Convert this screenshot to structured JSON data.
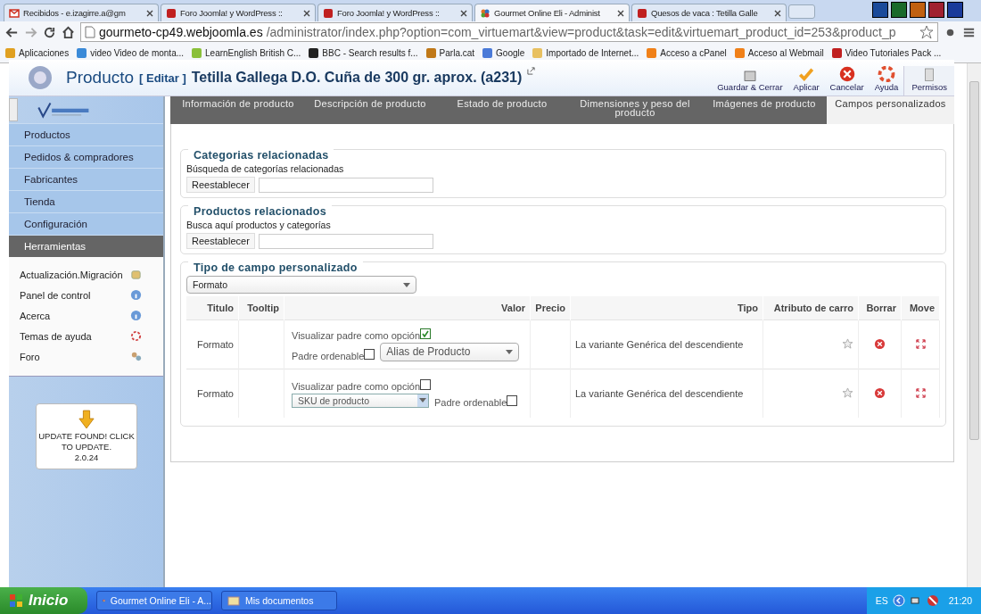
{
  "browser": {
    "tabs": [
      {
        "label": "Recibidos - e.izagirre.a@gm",
        "selected": false
      },
      {
        "label": "Foro Joomla! y WordPress ::",
        "selected": false
      },
      {
        "label": "Foro Joomla! y WordPress ::",
        "selected": false
      },
      {
        "label": "Gourmet Online Eli - Administ",
        "selected": true
      },
      {
        "label": "Quesos de vaca : Tetilla Galle",
        "selected": false
      }
    ],
    "address": {
      "host": "gourmeto-cp49.webjoomla.es",
      "path": "/administrator/index.php?option=com_virtuemart&view=product&task=edit&virtuemart_product_id=253&product_p"
    },
    "bookmarks": [
      {
        "label": "Aplicaciones",
        "color": "#e0a020"
      },
      {
        "label": "video Video de monta...",
        "color": "#3a8ad8"
      },
      {
        "label": "LearnEnglish  British C...",
        "color": "#8ac03a"
      },
      {
        "label": "BBC - Search results f...",
        "color": "#222222"
      },
      {
        "label": "Parla.cat",
        "color": "#c07818"
      },
      {
        "label": "Google",
        "color": "#4a7ad8"
      },
      {
        "label": "Importado de Internet...",
        "color": "#e8c060"
      },
      {
        "label": "Acceso a cPanel",
        "color": "#f08018"
      },
      {
        "label": "Acceso al Webmail",
        "color": "#f08018"
      },
      {
        "label": "Video Tutoriales Pack ...",
        "color": "#c02020"
      }
    ]
  },
  "header": {
    "title": "Producto",
    "edit": "[ Editar ]",
    "product": "Tetilla Gallega D.O. Cuña de 300 gr. aprox. (a231)",
    "toolbar": [
      "Guardar & Cerrar",
      "Aplicar",
      "Cancelar",
      "Ayuda",
      "Permisos"
    ]
  },
  "sidebar": {
    "menu": [
      {
        "label": "Productos",
        "selected": false
      },
      {
        "label": "Pedidos & compradores",
        "selected": false
      },
      {
        "label": "Fabricantes",
        "selected": false
      },
      {
        "label": "Tienda",
        "selected": false
      },
      {
        "label": "Configuración",
        "selected": false
      },
      {
        "label": "Herramientas",
        "selected": true
      }
    ],
    "tools": [
      "Actualización.Migración",
      "Panel de control",
      "Acerca",
      "Temas de ayuda",
      "Foro"
    ],
    "update": {
      "text": "UPDATE FOUND! CLICK TO UPDATE.",
      "version": "2.0.24"
    }
  },
  "tabs": [
    {
      "label": "Información de producto",
      "selected": false
    },
    {
      "label": "Descripción de producto",
      "selected": false
    },
    {
      "label": "Estado de producto",
      "selected": false
    },
    {
      "label": "Dimensiones y peso del producto",
      "selected": false
    },
    {
      "label": "Imágenes de producto",
      "selected": false
    },
    {
      "label": "Campos personalizados",
      "selected": true
    }
  ],
  "related": [
    {
      "legend": "Categorias relacionadas",
      "label": "Búsqueda de categorías relacionadas",
      "button": "Reestablecer"
    },
    {
      "legend": "Productos relacionados",
      "label": "Busca aquí productos y categorías",
      "button": "Reestablecer"
    }
  ],
  "custom": {
    "legend": "Tipo de campo personalizado",
    "select": "Formato",
    "columns": [
      "Titulo",
      "Tooltip",
      "Valor",
      "Precio",
      "Tipo",
      "Atributo de carro",
      "Borrar",
      "Move"
    ],
    "rows": [
      {
        "title": "Formato",
        "kind": "order-first",
        "display_label": "Visualizar padre como opción",
        "display_checked": true,
        "order_label": "Padre ordenable",
        "order_checked": false,
        "select": "Alias de Producto",
        "type": "La variante Genérica del descendiente"
      },
      {
        "title": "Formato",
        "kind": "select-first",
        "display_label": "Visualizar padre como opción",
        "display_checked": false,
        "order_label": "Padre ordenable",
        "order_checked": false,
        "select": "SKU de producto",
        "type": "La variante Genérica del descendiente"
      }
    ]
  },
  "taskbar": {
    "start": "Inicio",
    "items": [
      "Gourmet Online Eli - A...",
      "Mis documentos"
    ],
    "lang": "ES",
    "clock": "21:20"
  }
}
